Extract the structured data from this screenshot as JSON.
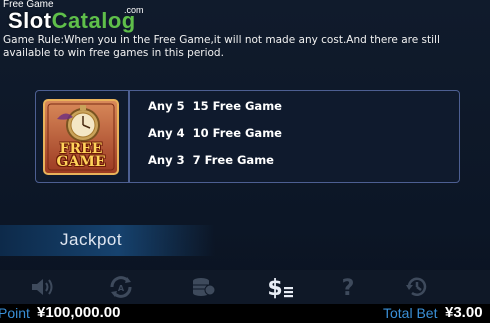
{
  "header": {
    "title": "Free Game",
    "watermark": {
      "slot": "Slot",
      "catalog": "Catalog",
      "com": ".com"
    }
  },
  "rule_text": "Game Rule:When you in the Free Game,it will not made any cost.And there are still available to win free games in this period.",
  "free_game_table": {
    "badge_text": "FREE GAME",
    "rows": [
      {
        "label": "Any 5  15 Free Game"
      },
      {
        "label": "Any 4  10 Free Game"
      },
      {
        "label": "Any 3  7 Free Game"
      }
    ]
  },
  "jackpot_label": "Jackpot",
  "toolbar": {
    "buttons": [
      {
        "icon": "speaker-icon"
      },
      {
        "icon": "autoplay-icon"
      },
      {
        "icon": "coins-icon"
      },
      {
        "icon": "paytable-icon"
      },
      {
        "icon": "help-icon"
      },
      {
        "icon": "history-icon"
      }
    ]
  },
  "status": {
    "point_label": "Point",
    "point_value": "¥100,000.00",
    "total_bet_label": "Total Bet",
    "total_bet_value": "¥3.00"
  },
  "colors": {
    "background": "#0c1626",
    "panel_border": "#4d5f92",
    "accent_blue": "#3a8fd6",
    "watermark_green": "#5fbf4a",
    "icon_gray": "#3e4a5c",
    "active_icon": "#e8edf5"
  }
}
